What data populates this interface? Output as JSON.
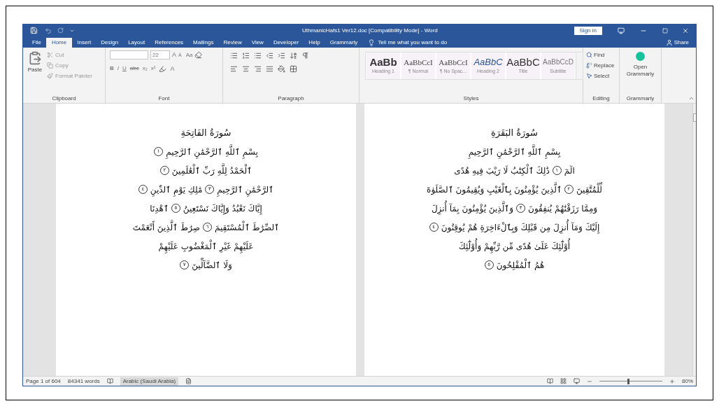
{
  "window": {
    "title": "UthmanicHafs1 Ver12.doc [Compatibility Mode] - Word",
    "sign_in": "Sign in"
  },
  "tabs": [
    {
      "label": "Grammarly",
      "selected": false
    },
    {
      "label": "Help",
      "selected": false
    },
    {
      "label": "Developer",
      "selected": false
    },
    {
      "label": "View",
      "selected": false
    },
    {
      "label": "Review",
      "selected": false
    },
    {
      "label": "Mailings",
      "selected": false
    },
    {
      "label": "References",
      "selected": false
    },
    {
      "label": "Layout",
      "selected": false
    },
    {
      "label": "Design",
      "selected": false
    },
    {
      "label": "Insert",
      "selected": false
    },
    {
      "label": "Home",
      "selected": true
    },
    {
      "label": "File",
      "selected": false
    }
  ],
  "tell_me": {
    "placeholder": "Tell me what you want to do"
  },
  "share": "Share",
  "ribbon": {
    "clipboard": {
      "label": "Clipboard",
      "paste": "Paste",
      "items": [
        "Cut",
        "Copy",
        "Format Painter"
      ]
    },
    "font": {
      "label": "Font",
      "size": "22",
      "grow": "A",
      "shrink": "A",
      "case": "Aa",
      "format_buttons": [
        "x²",
        "x₂",
        "abc",
        "U",
        "I",
        "B"
      ],
      "font_color_button": "A"
    },
    "paragraph": {
      "label": "Paragraph"
    },
    "styles": {
      "label": "Styles",
      "items": [
        {
          "preview": "AaBbCcD",
          "name": "Subtitle",
          "kind": "subtitle"
        },
        {
          "preview": "AaBbC",
          "name": "Title",
          "kind": "title"
        },
        {
          "preview": "AaBbC",
          "name": "Heading 2",
          "kind": "heading2"
        },
        {
          "preview": "AaBbCcI",
          "name": "¶ No Spac...",
          "kind": "normal"
        },
        {
          "preview": "AaBbCcI",
          "name": "¶ Normal",
          "kind": "normal"
        },
        {
          "preview": "AaBb",
          "name": "Heading 1",
          "kind": "heading1"
        }
      ]
    },
    "editing": {
      "label": "Editing",
      "items": [
        "Find",
        "Replace",
        "Select"
      ]
    },
    "grammarly": {
      "label": "Grammarly",
      "button": "Open Grammarly"
    }
  },
  "pages": [
    {
      "lines": [
        [
          {
            "kind": "title",
            "text": "سُورَةُ البَقَرَةِ"
          }
        ],
        [
          {
            "kind": "text",
            "text": "بِسْمِ ٱللَّهِ ٱلرَّحْمَٰنِ ٱلرَّحِيمِ"
          }
        ],
        [
          {
            "kind": "text",
            "text": "الٓمٓ"
          },
          {
            "kind": "ayah",
            "text": "١"
          },
          {
            "kind": "text",
            "text": "ذَٰلِكَ ٱلْكِتَٰبُ لَا رَيْبَ فِيهِ هُدًى"
          }
        ],
        [
          {
            "kind": "text",
            "text": "لِّلْمُتَّقِينَ"
          },
          {
            "kind": "ayah",
            "text": "٢"
          },
          {
            "kind": "text",
            "text": "ٱلَّذِينَ يُؤْمِنُونَ بِٱلْغَيْبِ وَيُقِيمُونَ ٱلصَّلَوٰةَ"
          }
        ],
        [
          {
            "kind": "text",
            "text": "وَمِمَّا رَزَقْنَٰهُمْ يُنفِقُونَ"
          },
          {
            "kind": "ayah",
            "text": "٣"
          },
          {
            "kind": "text",
            "text": "وَٱلَّذِينَ يُؤْمِنُونَ بِمَآ أُنزِلَ"
          }
        ],
        [
          {
            "kind": "text",
            "text": "إِلَيْكَ وَمَآ أُنزِلَ مِن قَبْلِكَ وَبِٱلْءَاخِرَةِ هُمْ يُوقِنُونَ"
          },
          {
            "kind": "ayah",
            "text": "٤"
          }
        ],
        [
          {
            "kind": "text",
            "text": "أُوْلَٰٓئِكَ عَلَىٰ هُدًى مِّن رَّبِّهِمْ وَأُوْلَٰٓئِكَ"
          }
        ],
        [
          {
            "kind": "text",
            "text": "هُمُ ٱلْمُفْلِحُونَ"
          },
          {
            "kind": "ayah",
            "text": "٥"
          }
        ]
      ]
    },
    {
      "lines": [
        [
          {
            "kind": "title",
            "text": "سُورَةُ الفَاتِحَةِ"
          }
        ],
        [
          {
            "kind": "text",
            "text": "بِسْمِ ٱللَّهِ ٱلرَّحْمَٰنِ ٱلرَّحِيمِ"
          },
          {
            "kind": "ayah",
            "text": "١"
          }
        ],
        [
          {
            "kind": "text",
            "text": "ٱلْحَمْدُ لِلَّهِ رَبِّ ٱلْعَٰلَمِينَ"
          },
          {
            "kind": "ayah",
            "text": "٢"
          }
        ],
        [
          {
            "kind": "text",
            "text": "ٱلرَّحْمَٰنِ ٱلرَّحِيمِ"
          },
          {
            "kind": "ayah",
            "text": "٣"
          },
          {
            "kind": "text",
            "text": "مَٰلِكِ يَوْمِ ٱلدِّينِ"
          },
          {
            "kind": "ayah",
            "text": "٤"
          }
        ],
        [
          {
            "kind": "text",
            "text": "إِيَّاكَ نَعْبُدُ وَإِيَّاكَ نَسْتَعِينُ"
          },
          {
            "kind": "ayah",
            "text": "٥"
          },
          {
            "kind": "text",
            "text": "ٱهْدِنَا"
          }
        ],
        [
          {
            "kind": "text",
            "text": "ٱلصِّرَٰطَ ٱلْمُسْتَقِيمَ"
          },
          {
            "kind": "ayah",
            "text": "٦"
          },
          {
            "kind": "text",
            "text": "صِرَٰطَ ٱلَّذِينَ أَنْعَمْتَ"
          }
        ],
        [
          {
            "kind": "text",
            "text": "عَلَيْهِمْ غَيْرِ ٱلْمَغْضُوبِ عَلَيْهِمْ"
          }
        ],
        [
          {
            "kind": "text",
            "text": "وَلَا ٱلضَّآلِّينَ"
          },
          {
            "kind": "ayah",
            "text": "٧"
          }
        ]
      ]
    }
  ],
  "status_bar": {
    "page": "Page 1 of 604",
    "words": "84341 words",
    "language": "Arabic (Saudi Arabia)",
    "zoom": "80%",
    "zoom_slider": {
      "level": 0.45
    }
  }
}
